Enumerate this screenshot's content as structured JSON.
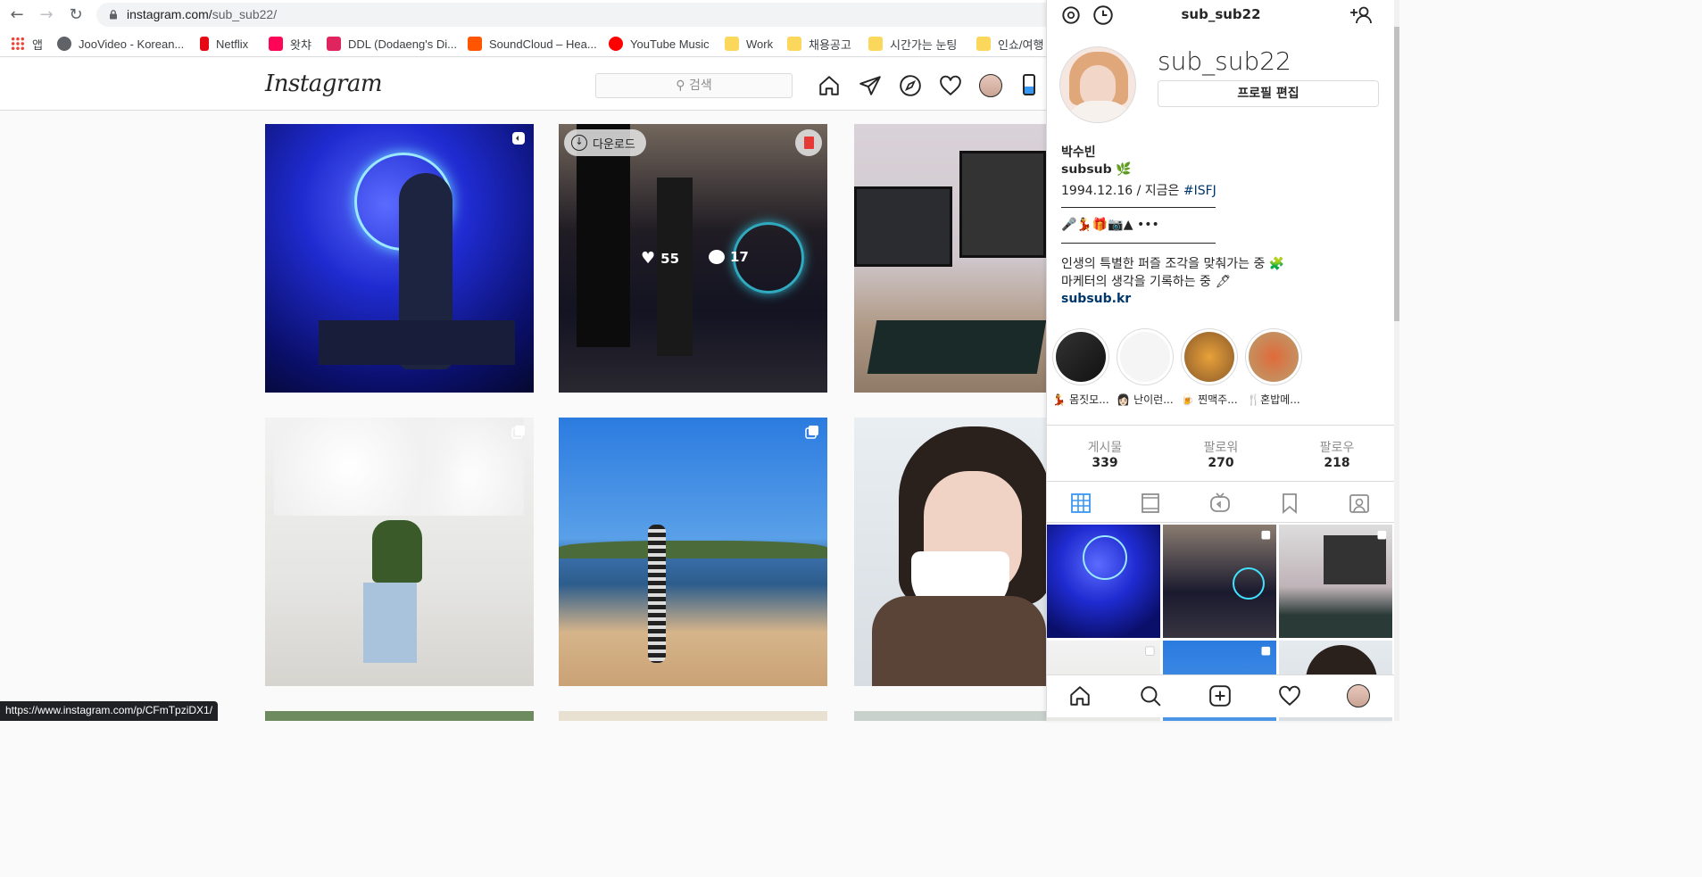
{
  "browser": {
    "url_host": "instagram.com/",
    "url_path": "sub_sub22/",
    "bookmarks": [
      {
        "label": "앱",
        "color": "#4285f4"
      },
      {
        "label": "JooVideo - Korean...",
        "color": "#5f6368"
      },
      {
        "label": "Netflix",
        "color": "#e50914"
      },
      {
        "label": "왓챠",
        "color": "#ff0558"
      },
      {
        "label": "DDL (Dodaeng's Di...",
        "color": "#e0245e"
      },
      {
        "label": "SoundCloud – Hea...",
        "color": "#ff5500"
      },
      {
        "label": "YouTube Music",
        "color": "#ff0000"
      },
      {
        "label": "Work",
        "color": "#fbd75b"
      },
      {
        "label": "채용공고",
        "color": "#fbd75b"
      },
      {
        "label": "시간가는 눈팅",
        "color": "#fbd75b"
      },
      {
        "label": "인쇼/여행",
        "color": "#fbd75b"
      }
    ],
    "status_url": "https://www.instagram.com/p/CFmTpziDX1/"
  },
  "header": {
    "logo": "Instagram",
    "search_placeholder": "검색",
    "icons": [
      "home-icon",
      "direct-icon",
      "explore-icon",
      "heart-icon",
      "profile-avatar",
      "mobile-icon"
    ]
  },
  "grid": {
    "post2": {
      "likes": "55",
      "comments": "17",
      "download_label": "다운로드"
    }
  },
  "panel": {
    "username": "sub_sub22",
    "handle": "sub_sub22",
    "edit_button": "프로필 편집",
    "bio": {
      "name": "박수빈",
      "subtitle": "𝘀𝘂𝗯𝘀𝘂𝗯 🌿",
      "line1_prefix": "1994.12.16 / 지금은 ",
      "line1_hashtag": "#ISFJ",
      "emoji_line": "🎤💃🎁📷▲ •••",
      "line2": "인생의 특별한 퍼즐 조각을 맞춰가는 중 🧩",
      "line3": "마케터의 생각을 기록하는 중 🖋",
      "website": "subsub.kr"
    },
    "highlights": [
      {
        "label": "💃 몸짓모..."
      },
      {
        "label": "👩🏻 난이런..."
      },
      {
        "label": "🍺 찐맥주..."
      },
      {
        "label": "🍴혼밥메..."
      }
    ],
    "stats": [
      {
        "label": "게시물",
        "value": "339"
      },
      {
        "label": "팔로워",
        "value": "270"
      },
      {
        "label": "팔로우",
        "value": "218"
      }
    ]
  }
}
